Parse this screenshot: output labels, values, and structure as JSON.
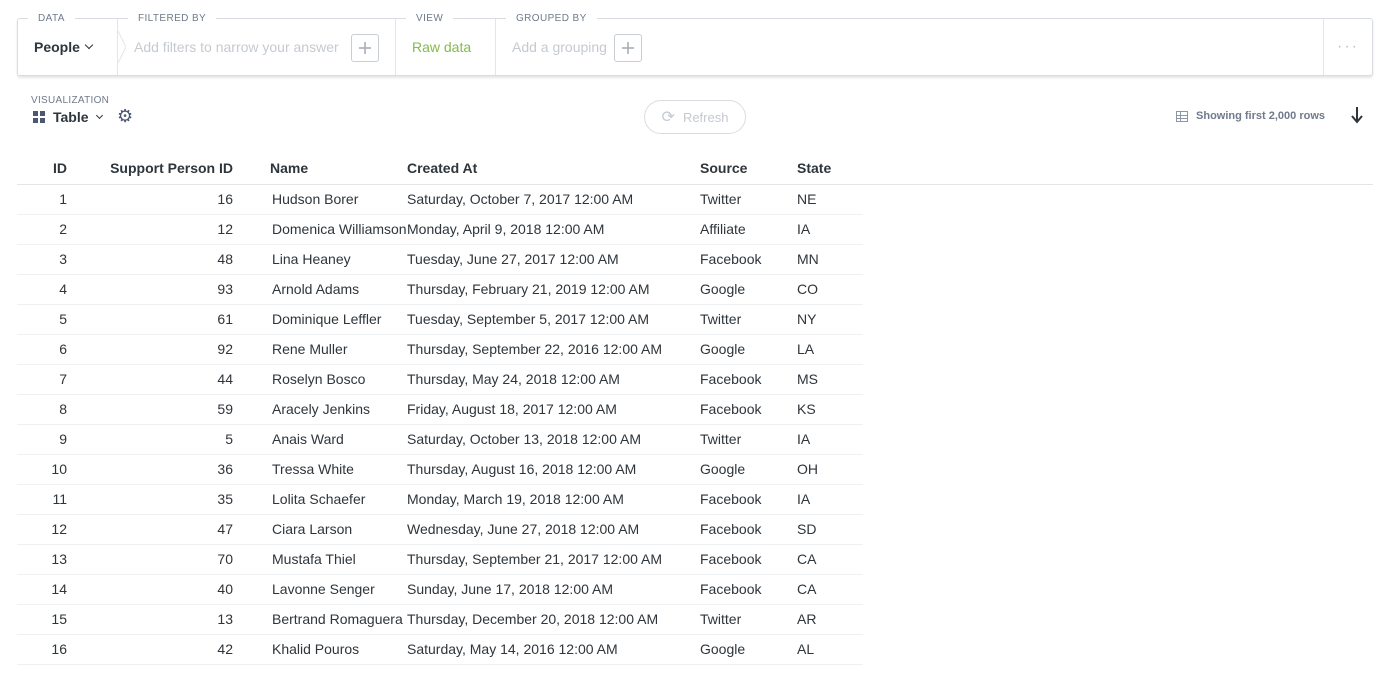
{
  "query_builder": {
    "data": {
      "label": "DATA",
      "value": "People"
    },
    "filter": {
      "label": "FILTERED BY",
      "placeholder": "Add filters to narrow your answer"
    },
    "view": {
      "label": "VIEW",
      "value": "Raw data"
    },
    "group": {
      "label": "GROUPED BY",
      "placeholder": "Add a grouping"
    }
  },
  "toolbar": {
    "viz_label": "VISUALIZATION",
    "viz_type": "Table",
    "refresh_label": "Refresh",
    "rows_info": "Showing first 2,000 rows"
  },
  "table": {
    "columns": [
      "ID",
      "Support Person ID",
      "Name",
      "Created At",
      "Source",
      "State"
    ],
    "rows": [
      [
        "1",
        "16",
        "Hudson Borer",
        "Saturday, October 7, 2017 12:00 AM",
        "Twitter",
        "NE"
      ],
      [
        "2",
        "12",
        "Domenica Williamson",
        "Monday, April 9, 2018 12:00 AM",
        "Affiliate",
        "IA"
      ],
      [
        "3",
        "48",
        "Lina Heaney",
        "Tuesday, June 27, 2017 12:00 AM",
        "Facebook",
        "MN"
      ],
      [
        "4",
        "93",
        "Arnold Adams",
        "Thursday, February 21, 2019 12:00 AM",
        "Google",
        "CO"
      ],
      [
        "5",
        "61",
        "Dominique Leffler",
        "Tuesday, September 5, 2017 12:00 AM",
        "Twitter",
        "NY"
      ],
      [
        "6",
        "92",
        "Rene Muller",
        "Thursday, September 22, 2016 12:00 AM",
        "Google",
        "LA"
      ],
      [
        "7",
        "44",
        "Roselyn Bosco",
        "Thursday, May 24, 2018 12:00 AM",
        "Facebook",
        "MS"
      ],
      [
        "8",
        "59",
        "Aracely Jenkins",
        "Friday, August 18, 2017 12:00 AM",
        "Facebook",
        "KS"
      ],
      [
        "9",
        "5",
        "Anais Ward",
        "Saturday, October 13, 2018 12:00 AM",
        "Twitter",
        "IA"
      ],
      [
        "10",
        "36",
        "Tressa White",
        "Thursday, August 16, 2018 12:00 AM",
        "Google",
        "OH"
      ],
      [
        "11",
        "35",
        "Lolita Schaefer",
        "Monday, March 19, 2018 12:00 AM",
        "Facebook",
        "IA"
      ],
      [
        "12",
        "47",
        "Ciara Larson",
        "Wednesday, June 27, 2018 12:00 AM",
        "Facebook",
        "SD"
      ],
      [
        "13",
        "70",
        "Mustafa Thiel",
        "Thursday, September 21, 2017 12:00 AM",
        "Facebook",
        "CA"
      ],
      [
        "14",
        "40",
        "Lavonne Senger",
        "Sunday, June 17, 2018 12:00 AM",
        "Facebook",
        "CA"
      ],
      [
        "15",
        "13",
        "Bertrand Romaguera",
        "Thursday, December 20, 2018 12:00 AM",
        "Twitter",
        "AR"
      ],
      [
        "16",
        "42",
        "Khalid Pouros",
        "Saturday, May 14, 2016 12:00 AM",
        "Google",
        "AL"
      ]
    ]
  },
  "colors": {
    "accent_green": "#84bb4c",
    "text": "#2e353b",
    "muted": "#6f7a8b",
    "border": "#d9dde1"
  },
  "icons": {
    "data_dropdown": "chevron-down-icon",
    "add_filter": "plus-icon",
    "add_grouping": "plus-icon",
    "more": "ellipsis-icon",
    "viz_type": "grid-icon",
    "settings": "gear-icon",
    "refresh": "refresh-icon",
    "rows": "table-icon",
    "download": "download-icon"
  }
}
